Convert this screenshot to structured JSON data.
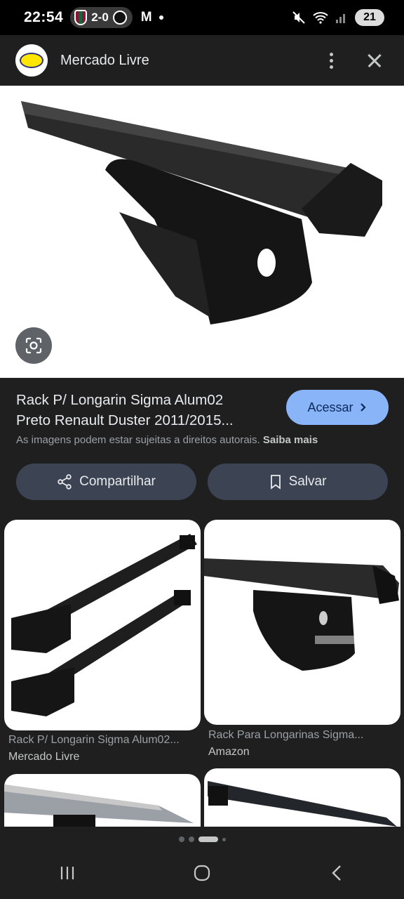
{
  "status_bar": {
    "time": "22:54",
    "score": "2-0",
    "gmail_icon": "M",
    "battery": "21"
  },
  "app_bar": {
    "title": "Mercado Livre"
  },
  "product": {
    "title_line1": "Rack P/ Longarin Sigma Alum02",
    "title_line2": "Preto Renault Duster 2011/2015...",
    "visit_label": "Acessar",
    "copyright_text": "As imagens podem estar sujeitas a direitos autorais.",
    "learn_more": "Saiba mais"
  },
  "actions": {
    "share_label": "Compartilhar",
    "save_label": "Salvar"
  },
  "related": [
    {
      "caption": "Rack P/ Longarin Sigma Alum02...",
      "source": "Mercado Livre"
    },
    {
      "caption": "Rack Para Longarinas Sigma...",
      "source": "Amazon"
    }
  ],
  "icons": {
    "lens": "lens-icon",
    "share": "share-icon",
    "bookmark": "bookmark-icon",
    "more": "more-vert-icon",
    "close": "close-icon"
  },
  "colors": {
    "accent": "#8ab4f8",
    "background": "#1f1f1f",
    "chip": "#3c4453"
  }
}
